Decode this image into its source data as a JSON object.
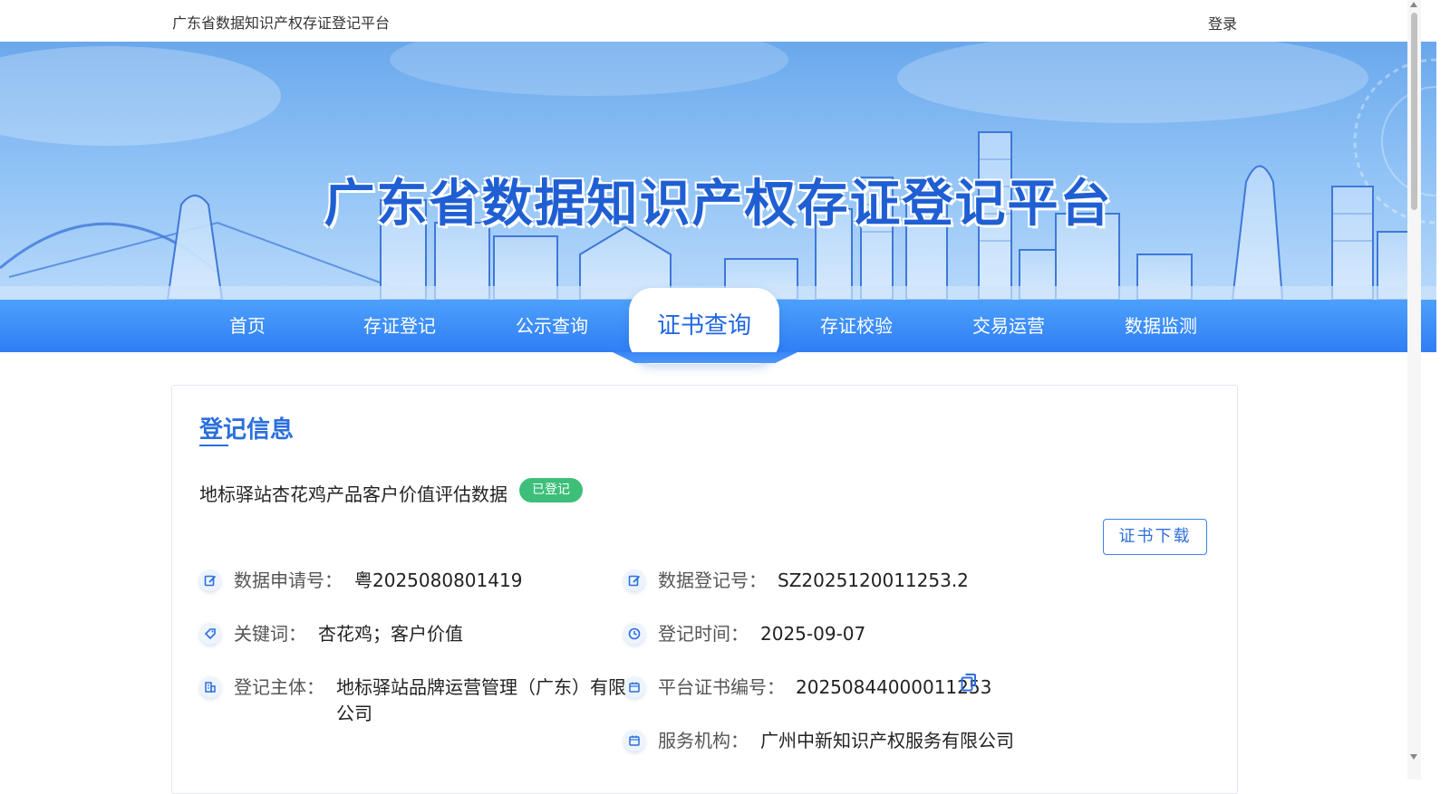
{
  "header": {
    "site_name": "广东省数据知识产权存证登记平台",
    "login_label": "登录"
  },
  "banner": {
    "title": "广东省数据知识产权存证登记平台"
  },
  "nav": {
    "items": [
      {
        "label": "首页"
      },
      {
        "label": "存证登记"
      },
      {
        "label": "公示查询"
      },
      {
        "label": "证书查询",
        "active": true
      },
      {
        "label": "存证校验"
      },
      {
        "label": "交易运营"
      },
      {
        "label": "数据监测"
      }
    ]
  },
  "card": {
    "title": "登记信息",
    "record_name": "地标驿站杏花鸡产品客户价值评估数据",
    "status": "已登记",
    "download_label": "证书下载",
    "fields": {
      "application_no": {
        "label": "数据申请号：",
        "value": "粤2025080801419",
        "icon": "edit-icon"
      },
      "registration_no": {
        "label": "数据登记号：",
        "value": "SZ2025120011253.2",
        "icon": "edit-icon"
      },
      "keywords": {
        "label": "关键词：",
        "value": "杏花鸡；客户价值",
        "icon": "tag-icon"
      },
      "registration_time": {
        "label": "登记时间：",
        "value": "2025-09-07",
        "icon": "clock-icon"
      },
      "subject": {
        "label": "登记主体：",
        "value_line1": "地标驿站品牌运营管理（广东）有限",
        "value_line2": "公司",
        "icon": "building-icon"
      },
      "certificate_no": {
        "label": "平台证书编号：",
        "value": "20250844000011253",
        "icon": "calendar-icon"
      },
      "service_org": {
        "label": "服务机构：",
        "value": "广州中新知识产权服务有限公司",
        "icon": "calendar-icon"
      }
    }
  },
  "colors": {
    "accent": "#2a6fdc",
    "nav_blue": "#2f7ef5",
    "status_green": "#3dbf7a"
  }
}
